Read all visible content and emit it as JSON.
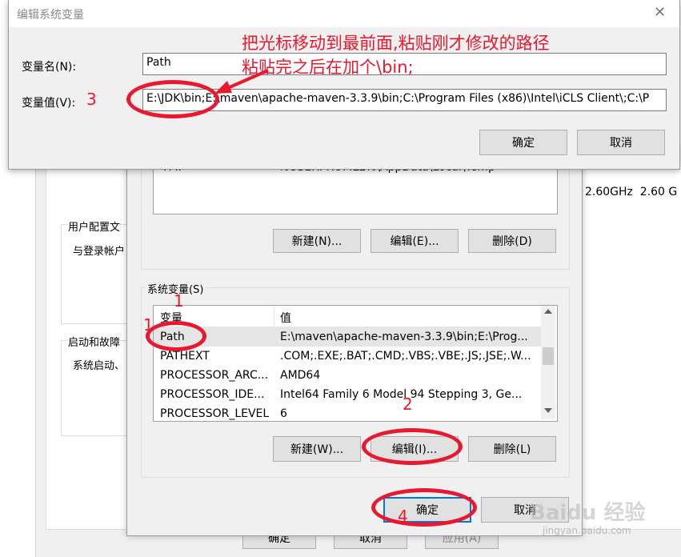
{
  "edit_dialog": {
    "title": "编辑系统变量",
    "close_glyph": "✕",
    "name_label": "变量名(N):",
    "name_value": "Path",
    "value_label": "变量值(V):",
    "value_value": "E:\\JDK\\bin;E:\\maven\\apache-maven-3.3.9\\bin;C:\\Program Files (x86)\\Intel\\iCLS Client\\;C:\\P",
    "ok_label": "确定",
    "cancel_label": "取消"
  },
  "annotation": {
    "line1": "把光标移动到最前面,粘贴刚才修改的路径",
    "line2": "粘贴完之后在加个\\bin;",
    "step1": "1",
    "step1b": "1",
    "step2": "2",
    "step3": "3",
    "step4": "4"
  },
  "system_props_bg": {
    "cpu_speed": "2.60GHz  2.60 G",
    "user_profiles_label": "用户配置文",
    "user_profiles_desc": "与登录帐户",
    "startup_label": "启动和故障",
    "startup_desc": "系统启动、",
    "ok_label": "确定",
    "cancel_label": "取消",
    "apply_label": "应用(A)"
  },
  "env_dialog": {
    "user_vars_partial_name": "TMP",
    "user_vars_partial_value": "%USERPROFILE%\\AppData\\Local\\Temp",
    "user_new_label": "新建(N)...",
    "user_edit_label": "编辑(E)...",
    "user_delete_label": "删除(D)",
    "system_vars_title": "系统变量(S)",
    "col_variable": "变量",
    "col_value": "值",
    "rows": [
      {
        "name": "Path",
        "value": "E:\\maven\\apache-maven-3.3.9\\bin;E:\\Prog..."
      },
      {
        "name": "PATHEXT",
        "value": ".COM;.EXE;.BAT;.CMD;.VBS;.VBE;.JS;.JSE;.W..."
      },
      {
        "name": "PROCESSOR_ARC...",
        "value": "AMD64"
      },
      {
        "name": "PROCESSOR_IDE...",
        "value": "Intel64 Family 6 Model 94 Stepping 3, Ge..."
      },
      {
        "name": "PROCESSOR_LEVEL",
        "value": "6"
      }
    ],
    "sys_new_label": "新建(W)...",
    "sys_edit_label": "编辑(I)...",
    "sys_delete_label": "删除(L)",
    "ok_label": "确定",
    "cancel_label": "取消"
  },
  "watermark": {
    "brand": "Baidu 经验",
    "url": "jingyan.baidu.com"
  }
}
